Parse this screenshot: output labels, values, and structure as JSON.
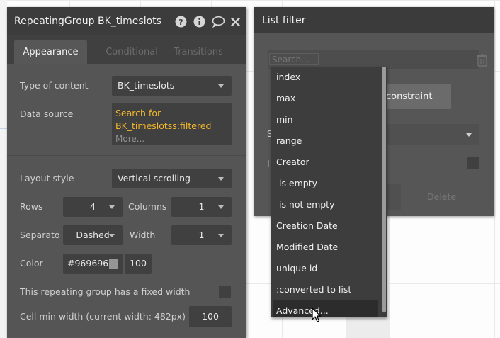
{
  "left_panel": {
    "title": "RepeatingGroup BK_timeslots",
    "tabs": [
      "Appearance",
      "Conditional",
      "Transitions"
    ],
    "type_of_content": {
      "label": "Type of content",
      "value": "BK_timeslots"
    },
    "data_source": {
      "label": "Data source",
      "value": "Search for BK_timeslotss:filtered",
      "more": "More..."
    },
    "layout_style": {
      "label": "Layout style",
      "value": "Vertical scrolling"
    },
    "rows": {
      "label": "Rows",
      "value": "4"
    },
    "columns": {
      "label": "Columns",
      "value": "1"
    },
    "separator": {
      "label": "Separato",
      "value": "Dashed"
    },
    "width": {
      "label": "Width",
      "value": "1"
    },
    "color": {
      "label": "Color",
      "hex": "#969696",
      "opacity": "100"
    },
    "fixed_width": {
      "label": "This repeating group has a fixed width"
    },
    "cell_min_width": {
      "label": "Cell min width (current width: 482px)",
      "value": "100"
    }
  },
  "right_panel": {
    "title": "List filter",
    "search_placeholder": "Search...",
    "constraint_label": "constraint",
    "peek_s": "S",
    "peek_i": "I",
    "delete_label": "Delete"
  },
  "menu": {
    "items": [
      "index",
      "max",
      "min",
      "range",
      "Creator",
      " is empty",
      " is not empty",
      "Creation Date",
      "Modified Date",
      "unique id",
      ":converted to list",
      "Advanced..."
    ]
  },
  "colors": {
    "panel": "#555555",
    "header": "#3c3c3c",
    "field": "#404040",
    "accent": "#f4b82a"
  }
}
